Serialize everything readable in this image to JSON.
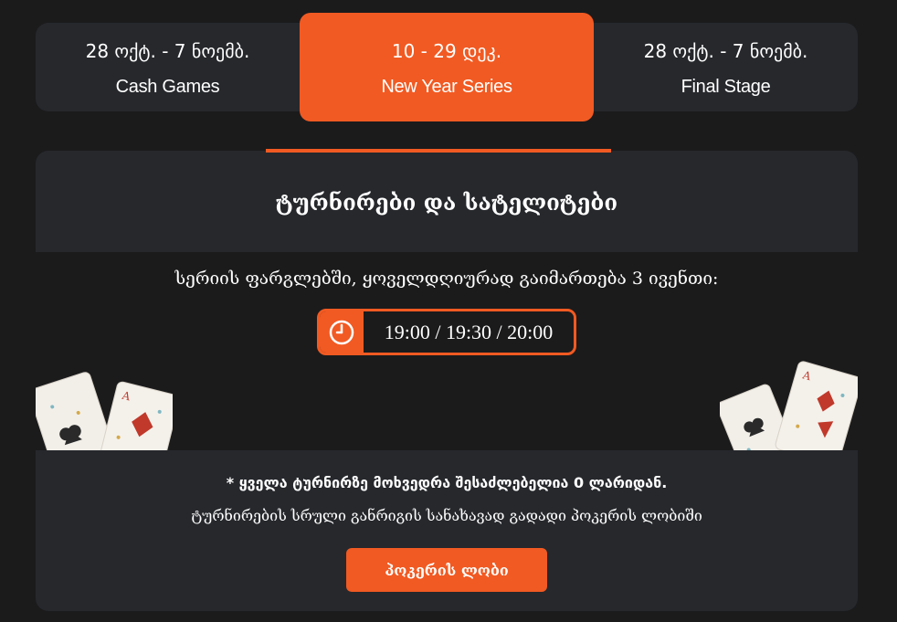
{
  "tabs": [
    {
      "date": "28 ოქტ. - 7 ნოემბ.",
      "name": "Cash Games",
      "active": false
    },
    {
      "date": "10 - 29 დეკ.",
      "name": "New Year Series",
      "active": true
    },
    {
      "date": "28 ოქტ. - 7 ნოემბ.",
      "name": "Final Stage",
      "active": false
    }
  ],
  "panel": {
    "title": "ტურნირები და სატელიტები",
    "series_text": "სერიის ფარგლებში, ყოველდღიურად გაიმართება 3 ივენთი:",
    "clock_icon": "clock-icon",
    "times": "19:00 / 19:30 / 20:00",
    "note_prefix": "* ყველა ტურნირზე მოხვედრა შესაძლებელია ",
    "note_amount": "0",
    "note_suffix": " ლარიდან.",
    "note_line2": "ტურნირების სრული განრიგის სანახავად გადადი პოკერის ლობიში",
    "lobby_button": "პოკერის ლობი"
  },
  "colors": {
    "accent": "#f15a22",
    "panel": "#26282c",
    "background": "#1b1b1c"
  }
}
